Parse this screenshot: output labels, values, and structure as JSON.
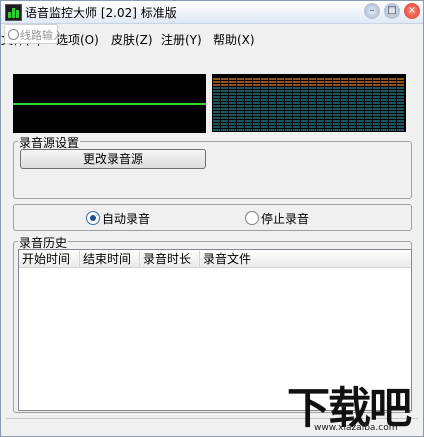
{
  "window": {
    "title": "语音监控大师 [2.02] 标准版"
  },
  "title_buttons": {
    "minimize": "–",
    "maximize": "□",
    "close": "×"
  },
  "menu": {
    "items": [
      "文件(F)",
      "选项(O)",
      "皮肤(Z)",
      "注册(Y)",
      "帮助(X)"
    ],
    "visible_items": [
      "皮肤(Z)",
      "注册(Y)",
      "帮助(X)"
    ]
  },
  "combo_overlay": {
    "text": "线路输入"
  },
  "recording_source": {
    "group_label": "录音源设置",
    "change_button": "更改录音源"
  },
  "record_mode": {
    "auto_label": "自动录音",
    "stop_label": "停止录音",
    "selected": "auto"
  },
  "history": {
    "group_label": "录音历史",
    "columns": [
      "开始时间",
      "结束时间",
      "录音时长",
      "录音文件"
    ],
    "rows": []
  },
  "colors": {
    "waveform_line": "#2ed12e",
    "spectrum_bar": "#2f9fb5",
    "spectrum_peak": "#c86d1a"
  },
  "watermark": {
    "brand": "下载吧",
    "url": "www.xiazaiba.com"
  }
}
